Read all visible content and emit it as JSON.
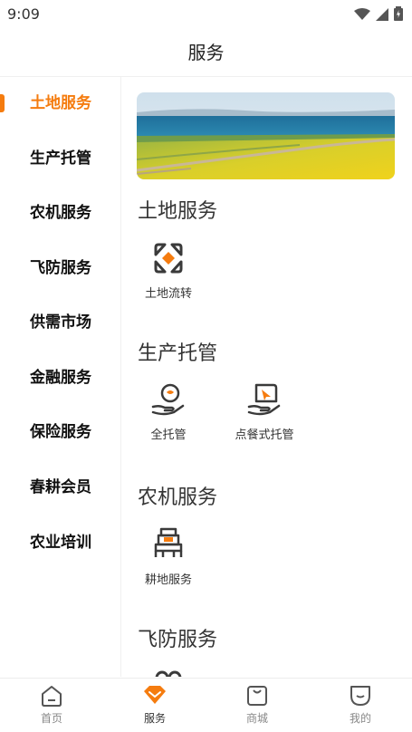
{
  "status": {
    "time": "9:09"
  },
  "header": {
    "title": "服务"
  },
  "sidebar": {
    "items": [
      {
        "label": "土地服务",
        "active": true
      },
      {
        "label": "生产托管"
      },
      {
        "label": "农机服务"
      },
      {
        "label": "飞防服务"
      },
      {
        "label": "供需市场"
      },
      {
        "label": "金融服务"
      },
      {
        "label": "保险服务"
      },
      {
        "label": "春耕会员"
      },
      {
        "label": "农业培训"
      }
    ]
  },
  "main": {
    "sections": [
      {
        "title": "土地服务",
        "items": [
          {
            "label": "土地流转",
            "icon": "land-transfer-icon"
          }
        ]
      },
      {
        "title": "生产托管",
        "items": [
          {
            "label": "全托管",
            "icon": "full-trusteeship-icon"
          },
          {
            "label": "点餐式托管",
            "icon": "order-trusteeship-icon"
          }
        ]
      },
      {
        "title": "农机服务",
        "items": [
          {
            "label": "耕地服务",
            "icon": "plowing-service-icon"
          }
        ]
      },
      {
        "title": "飞防服务",
        "items": []
      }
    ]
  },
  "bottom_nav": {
    "items": [
      {
        "label": "首页",
        "icon": "home-icon"
      },
      {
        "label": "服务",
        "icon": "service-icon",
        "active": true
      },
      {
        "label": "商城",
        "icon": "mall-icon"
      },
      {
        "label": "我的",
        "icon": "profile-icon"
      }
    ]
  },
  "colors": {
    "accent": "#f57c0f",
    "icon_dark": "#3a3a3a"
  }
}
